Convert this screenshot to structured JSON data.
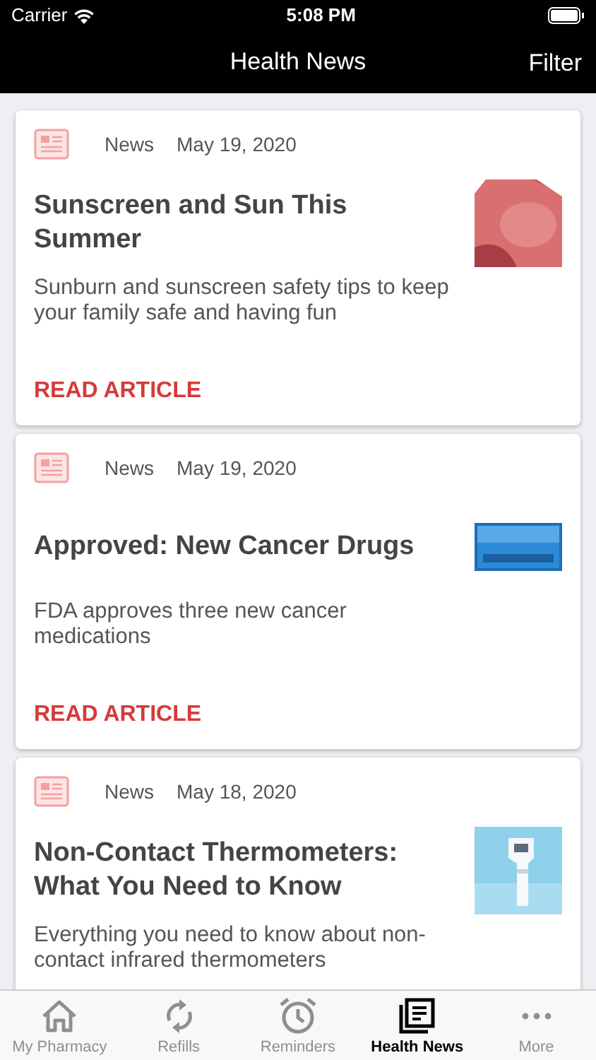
{
  "status_bar": {
    "carrier": "Carrier",
    "time": "5:08 PM"
  },
  "nav_bar": {
    "title": "Health News",
    "action": "Filter"
  },
  "articles": [
    {
      "category": "News",
      "date": "May 19, 2020",
      "title": "Sunscreen and Sun This Summer",
      "summary": "Sunburn and sunscreen safety tips to keep your family safe and having fun",
      "link": "READ ARTICLE"
    },
    {
      "category": "News",
      "date": "May 19, 2020",
      "title": "Approved: New Cancer Drugs",
      "summary": "FDA approves three new cancer medications",
      "link": "READ ARTICLE"
    },
    {
      "category": "News",
      "date": "May 18, 2020",
      "title": "Non-Contact Thermometers: What You Need to Know",
      "summary": "Everything you need to know about non-contact infrared thermometers"
    }
  ],
  "tab_bar": [
    {
      "label": "My Pharmacy",
      "selected": false,
      "kind": "home"
    },
    {
      "label": "Refills",
      "selected": false,
      "kind": "refill"
    },
    {
      "label": "Reminders",
      "selected": false,
      "kind": "alarm"
    },
    {
      "label": "Health News",
      "selected": true,
      "kind": "news"
    },
    {
      "label": "More",
      "selected": false,
      "kind": "more"
    }
  ]
}
